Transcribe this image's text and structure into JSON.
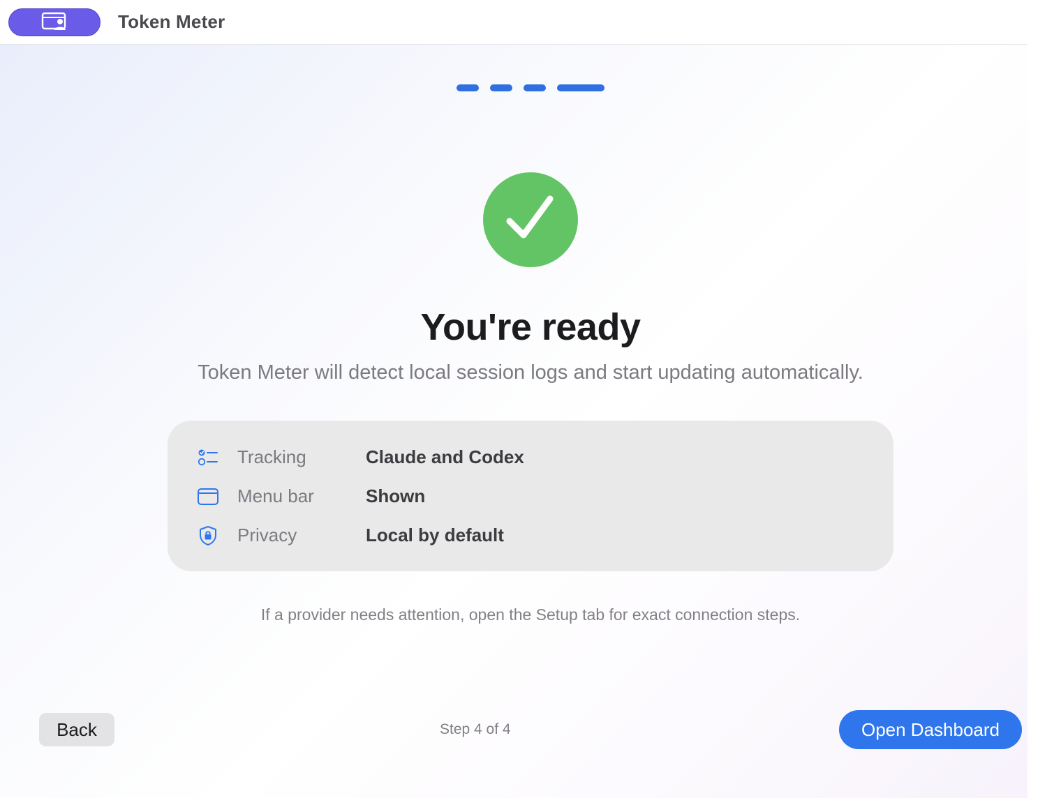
{
  "app": {
    "title": "Token Meter",
    "icon": "app-window-person-icon"
  },
  "onboarding": {
    "progress": {
      "current_step": 4,
      "total_steps": 4
    },
    "status_icon": "checkmark-circle-icon",
    "headline": "You're ready",
    "subtitle": "Token Meter will detect local session logs and start updating automatically.",
    "summary": [
      {
        "icon": "checklist-icon",
        "label": "Tracking",
        "value": "Claude and Codex"
      },
      {
        "icon": "menu-bar-window-icon",
        "label": "Menu bar",
        "value": "Shown"
      },
      {
        "icon": "lock-shield-icon",
        "label": "Privacy",
        "value": "Local by default"
      }
    ],
    "hint": "If a provider needs attention, open the Setup tab for exact connection steps.",
    "footer": {
      "back_label": "Back",
      "step_label": "Step 4 of 4",
      "primary_label": "Open Dashboard"
    }
  },
  "colors": {
    "accent": "#2f76ed",
    "app_pill": "#6a5ce8",
    "success": "#63c466",
    "card_background": "#e9e9ea"
  }
}
